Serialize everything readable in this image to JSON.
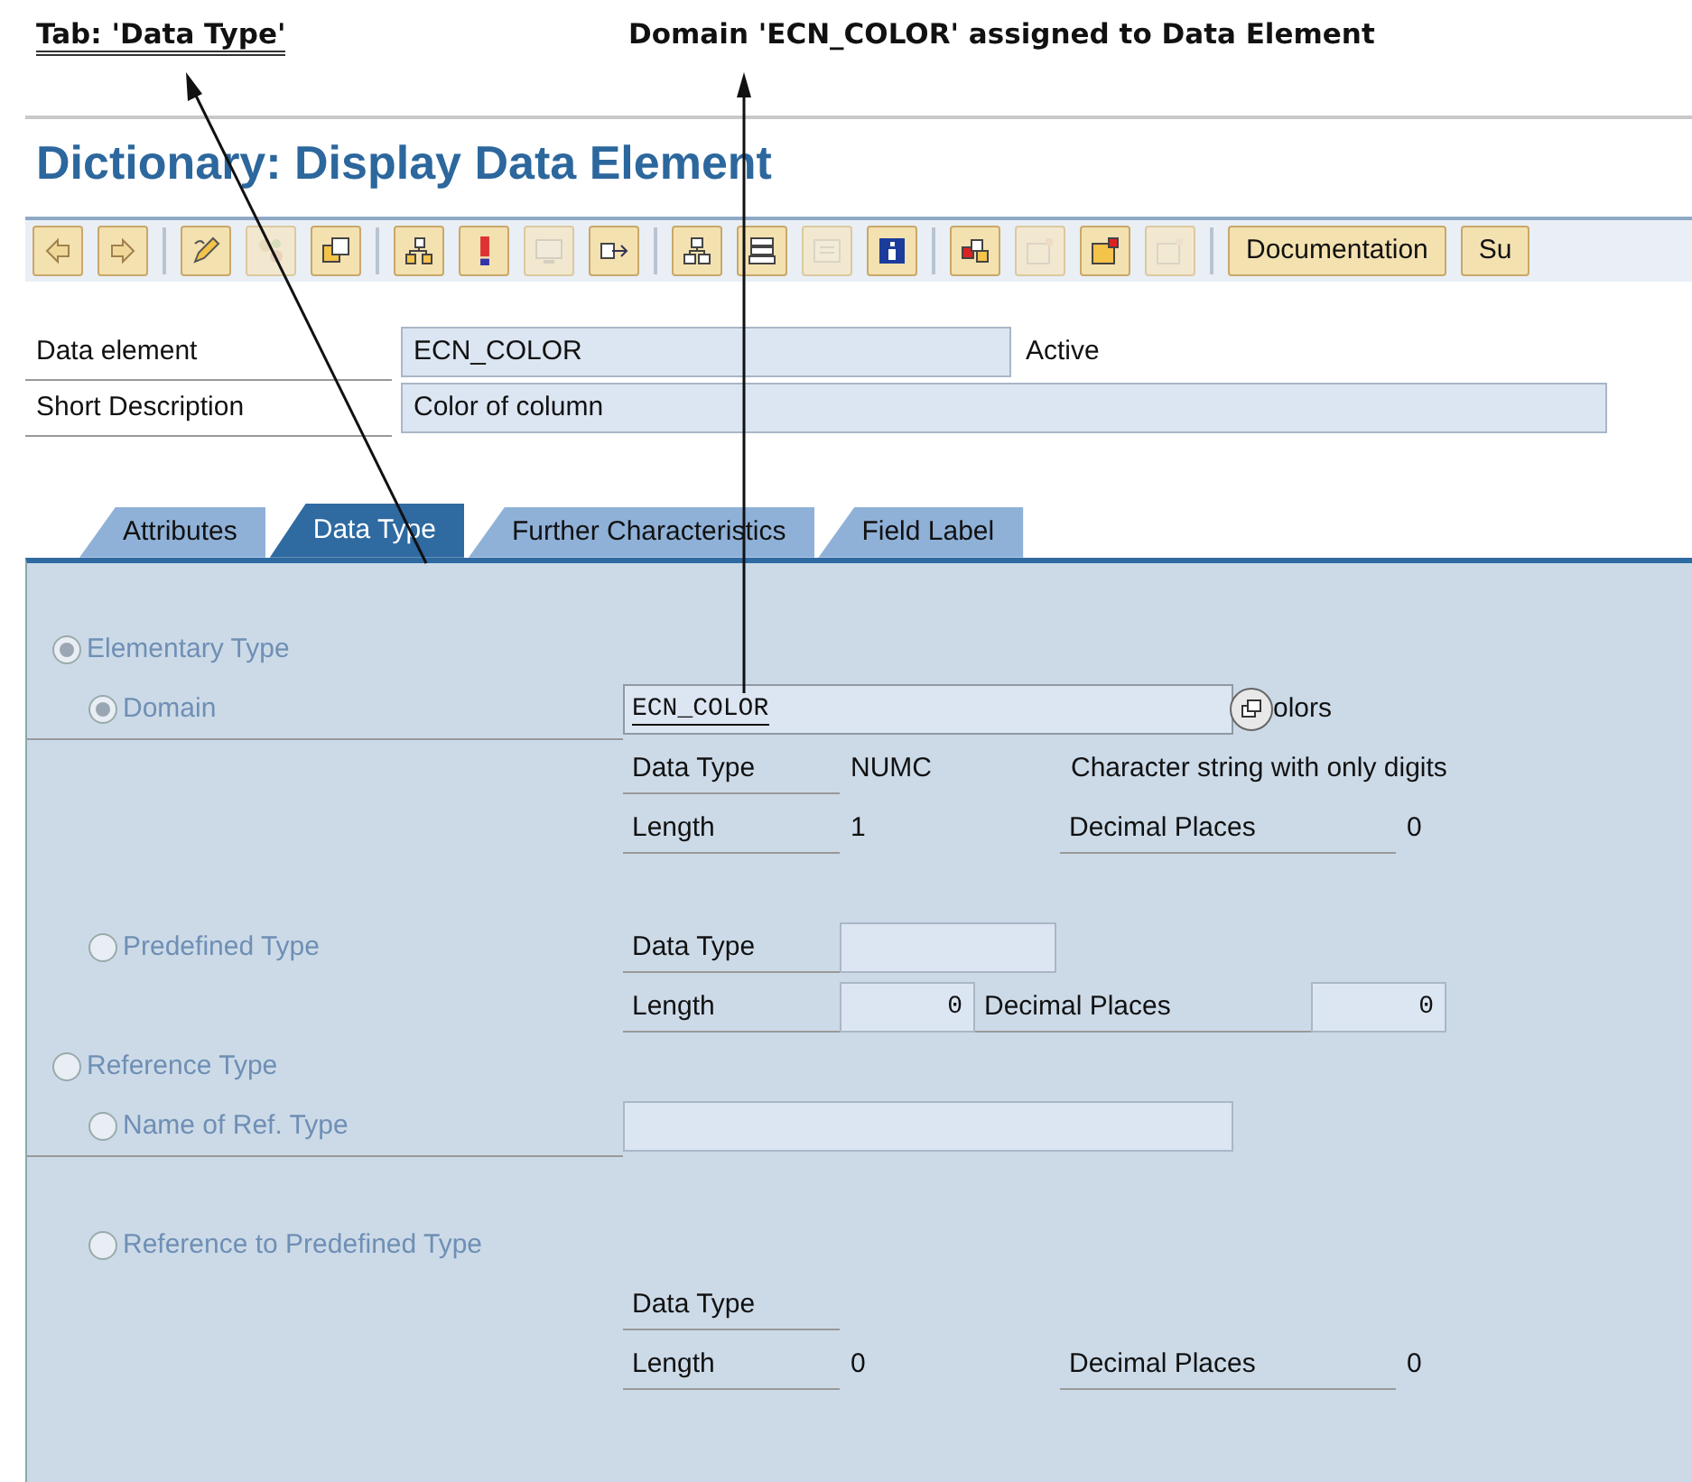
{
  "annotations": [
    {
      "kind": "tab-note",
      "text": "Tab: 'Data Type'"
    },
    {
      "kind": "domain-note",
      "text": "Domain 'ECN_COLOR' assigned to Data Element"
    }
  ],
  "title": "Dictionary: Display Data Element",
  "toolbar": {
    "groups": [
      [
        {
          "disabled": false
        },
        {
          "disabled": false
        }
      ],
      [
        {
          "disabled": false
        },
        {
          "disabled": true
        },
        {
          "disabled": false
        }
      ],
      [
        {
          "disabled": false
        },
        {
          "disabled": false
        },
        {
          "disabled": true
        },
        {
          "disabled": false
        }
      ],
      [
        {
          "disabled": false
        },
        {
          "disabled": false
        },
        {
          "disabled": true
        },
        {
          "disabled": false
        }
      ],
      [
        {
          "disabled": false
        },
        {
          "disabled": true
        },
        {
          "disabled": false
        },
        {
          "disabled": true
        }
      ]
    ],
    "buttons": [
      "Documentation",
      "Su"
    ]
  },
  "header_fields": [
    {
      "label": "Data element",
      "value": "ECN_COLOR",
      "status": "Active",
      "kind": "short"
    },
    {
      "label": "Short Description",
      "value": "Color of column",
      "kind": "long"
    }
  ],
  "tabs": [
    {
      "label": "Attributes",
      "selected": false
    },
    {
      "label": "Data Type",
      "selected": true
    },
    {
      "label": "Further Characteristics",
      "selected": false
    },
    {
      "label": "Field Label",
      "selected": false
    }
  ],
  "type_options": [
    {
      "label": "Elementary Type",
      "selected": true,
      "children": [
        {
          "kind": "domain",
          "label": "Domain",
          "selected": true,
          "value": "ECN_COLOR",
          "suffix": "olors",
          "details": [
            [
              {
                "kind": "label",
                "text": "Data Type"
              },
              {
                "kind": "value",
                "text": "NUMC"
              },
              {
                "kind": "text",
                "text": "Character string with only digits"
              }
            ],
            [
              {
                "kind": "label",
                "text": "Length"
              },
              {
                "kind": "value",
                "text": "1"
              },
              {
                "kind": "label",
                "text": "Decimal Places"
              },
              {
                "kind": "value",
                "text": "0"
              }
            ]
          ]
        },
        {
          "kind": "inline",
          "label": "Predefined Type",
          "selected": false,
          "details": [
            [
              {
                "kind": "label",
                "text": "Data Type"
              },
              {
                "kind": "input"
              }
            ],
            [
              {
                "kind": "label",
                "text": "Length"
              },
              {
                "kind": "input",
                "text": "0"
              },
              {
                "kind": "label",
                "text": "Decimal Places"
              },
              {
                "kind": "input",
                "text": "0"
              }
            ]
          ]
        }
      ]
    },
    {
      "label": "Reference Type",
      "selected": false,
      "children": [
        {
          "kind": "field",
          "label": "Name of Ref. Type",
          "selected": false
        },
        {
          "kind": "below",
          "label": "Reference to Predefined Type",
          "selected": false,
          "details": [
            [
              {
                "kind": "label",
                "text": "Data Type"
              }
            ],
            [
              {
                "kind": "label",
                "text": "Length"
              },
              {
                "kind": "value",
                "text": "0"
              },
              {
                "kind": "label",
                "text": "Decimal Places"
              },
              {
                "kind": "value",
                "text": "0"
              }
            ]
          ]
        }
      ]
    }
  ]
}
